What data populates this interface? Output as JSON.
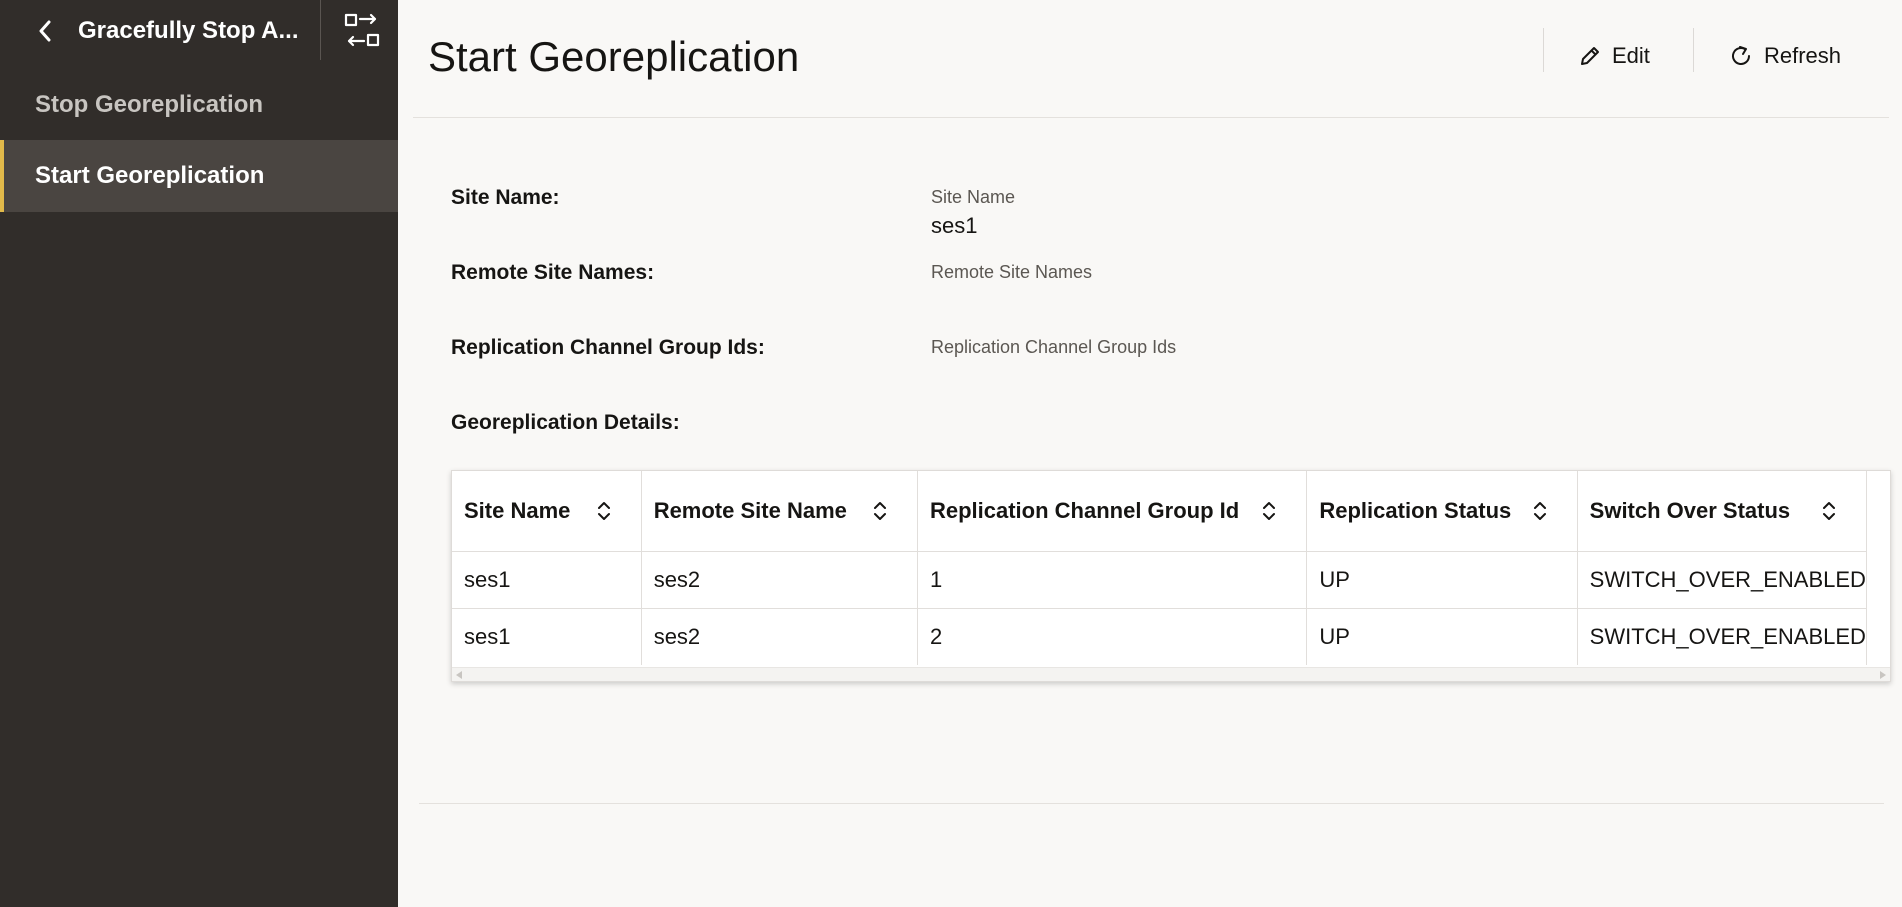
{
  "sidebar": {
    "title": "Gracefully Stop A...",
    "back_icon": "chevron-left-icon",
    "switch_icon": "swap-icon",
    "items": [
      {
        "label": "Stop Georeplication",
        "active": false
      },
      {
        "label": "Start Georeplication",
        "active": true
      }
    ],
    "accent_color": "#e1b94a"
  },
  "header": {
    "title": "Start Georeplication",
    "edit_label": "Edit",
    "refresh_label": "Refresh"
  },
  "form": {
    "site_name_label": "Site Name:",
    "site_name_hint": "Site Name",
    "site_name_value": "ses1",
    "remote_site_names_label": "Remote Site Names:",
    "remote_site_names_hint": "Remote Site Names",
    "channel_group_ids_label": "Replication Channel Group Ids:",
    "channel_group_ids_hint": "Replication Channel Group Ids",
    "details_label": "Georeplication Details:"
  },
  "table": {
    "columns": [
      "Site Name",
      "Remote Site Name",
      "Replication Channel Group Id",
      "Replication Status",
      "Switch Over Status"
    ],
    "rows": [
      [
        "ses1",
        "ses2",
        "1",
        "UP",
        "SWITCH_OVER_ENABLED"
      ],
      [
        "ses1",
        "ses2",
        "2",
        "UP",
        "SWITCH_OVER_ENABLED"
      ]
    ]
  }
}
